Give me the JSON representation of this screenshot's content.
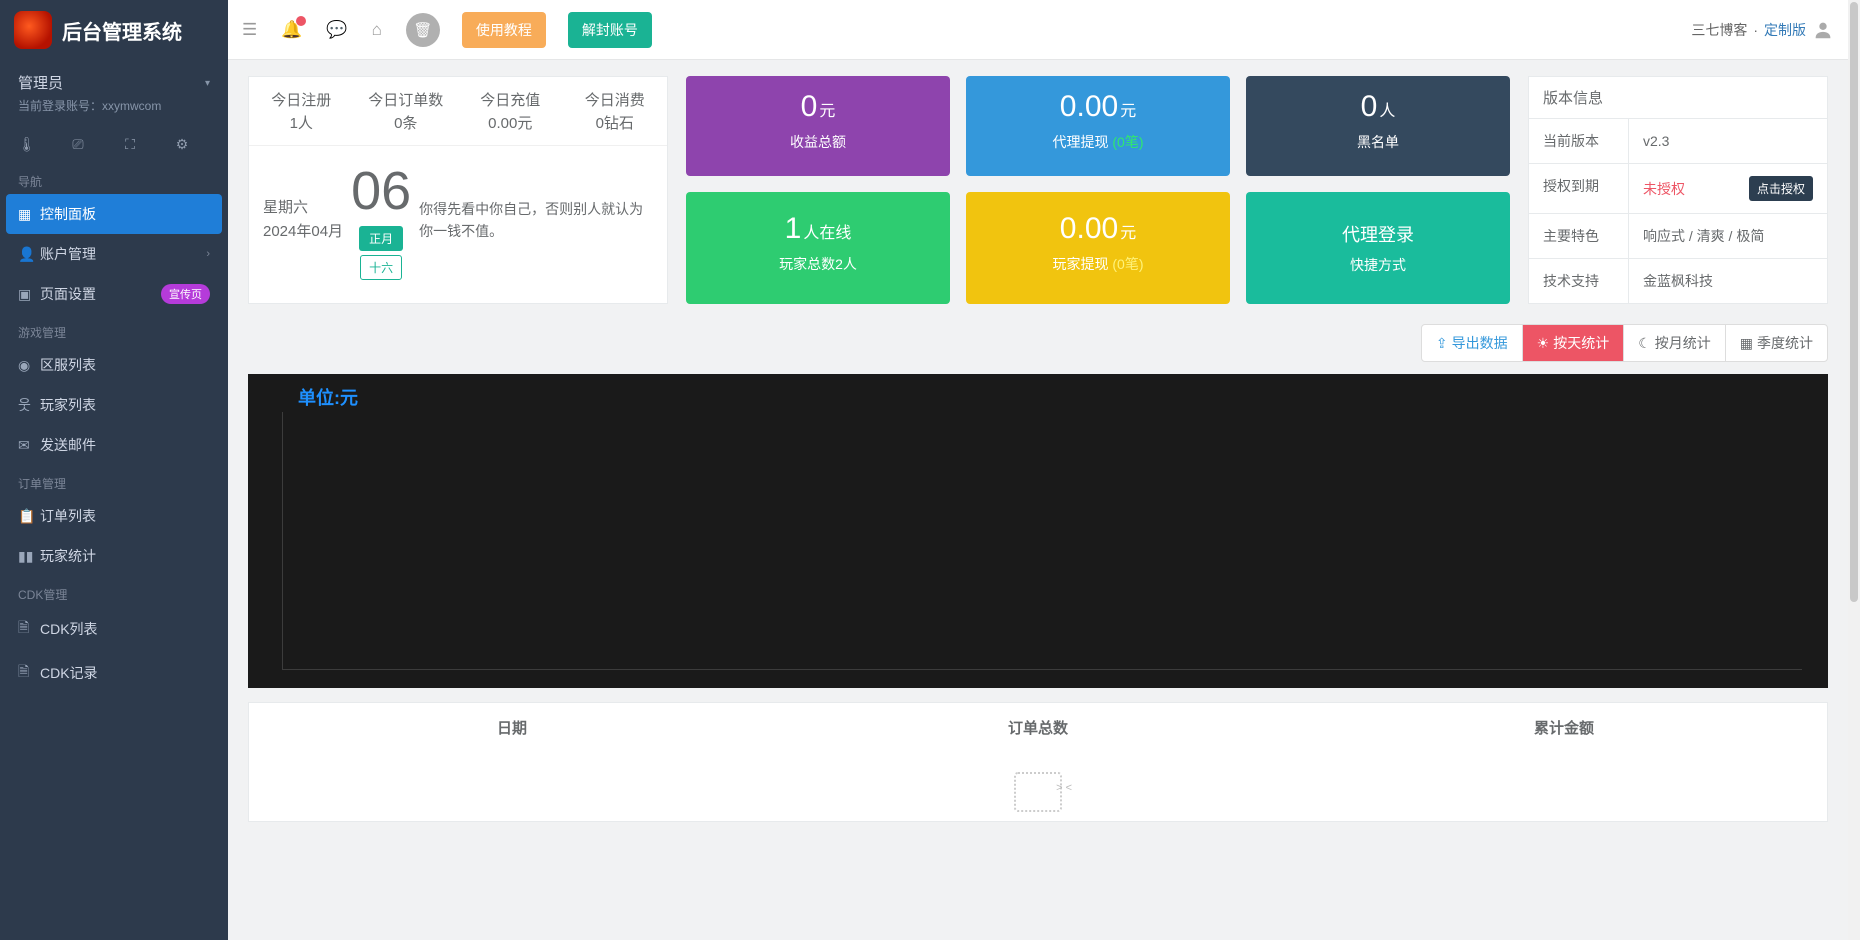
{
  "app_title": "后台管理系统",
  "admin": {
    "role": "管理员",
    "login_label": "当前登录账号：",
    "login_value": "xxymwcom"
  },
  "sidebar": {
    "sections": {
      "nav": "导航",
      "game": "游戏管理",
      "order": "订单管理",
      "cdk": "CDK管理"
    },
    "items": {
      "dashboard": "控制面板",
      "account": "账户管理",
      "page": "页面设置",
      "page_badge": "宣传页",
      "zone": "区服列表",
      "player": "玩家列表",
      "mail": "发送邮件",
      "orders": "订单列表",
      "stats": "玩家统计",
      "cdk_list": "CDK列表",
      "cdk_rec": "CDK记录"
    }
  },
  "header": {
    "btn_tutorial": "使用教程",
    "btn_unban": "解封账号",
    "brand_r1": "三七博客",
    "brand_sep": "·",
    "brand_r2": "定制版"
  },
  "today_stats": {
    "reg_t": "今日注册",
    "reg_v": "1人",
    "ord_t": "今日订单数",
    "ord_v": "0条",
    "rec_t": "今日充值",
    "rec_v": "0.00元",
    "con_t": "今日消费",
    "con_v": "0钻石"
  },
  "date": {
    "weekday": "星期六",
    "ym": "2024年04月",
    "day": "06",
    "tag1": "正月",
    "tag2": "十六",
    "quote": "你得先看中你自己，否则别人就认为你一钱不值。"
  },
  "cards": {
    "c1_num": "0",
    "c1_unit": "元",
    "c1_sub": "收益总额",
    "c2_num": "0.00",
    "c2_unit": "元",
    "c2_sub_a": "代理提现",
    "c2_sub_b": "(0笔)",
    "c3_num": "0",
    "c3_unit": "人",
    "c3_sub": "黑名单",
    "c4_num": "1",
    "c4_unit": "人在线",
    "c4_sub": "玩家总数2人",
    "c5_num": "0.00",
    "c5_unit": "元",
    "c5_sub_a": "玩家提现",
    "c5_sub_b": "(0笔)",
    "c6_title": "代理登录",
    "c6_sub": "快捷方式"
  },
  "version": {
    "title": "版本信息",
    "k1": "当前版本",
    "v1": "v2.3",
    "k2": "授权到期",
    "v2": "未授权",
    "v2_btn": "点击授权",
    "k3": "主要特色",
    "v3": "响应式 / 清爽 / 极简",
    "k4": "技术支持",
    "v4": "金蓝枫科技"
  },
  "toolbar": {
    "export": "导出数据",
    "by_day": "按天统计",
    "by_month": "按月统计",
    "by_quarter": "季度统计"
  },
  "chart_data": {
    "type": "line",
    "title": "单位:元",
    "series": [],
    "x": [],
    "ylabel": "元"
  },
  "table": {
    "h1": "日期",
    "h2": "订单总数",
    "h3": "累计金额"
  }
}
